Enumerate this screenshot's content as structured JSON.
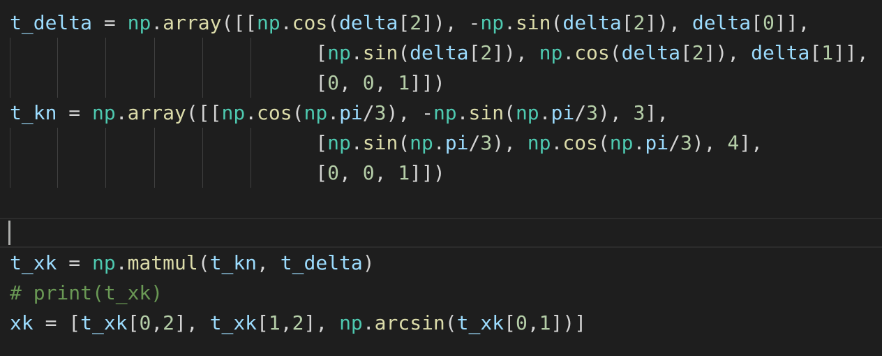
{
  "editor": {
    "theme_colors": {
      "background": "#1e1e1e",
      "variable": "#9cdcfe",
      "module": "#4ec9b0",
      "function": "#dcdcaa",
      "number": "#b5cea8",
      "plain": "#d4d4d4",
      "comment": "#6a9955"
    },
    "lines": [
      {
        "tokens": [
          {
            "t": "t_delta",
            "k": "var"
          },
          {
            "t": " = ",
            "k": "op"
          },
          {
            "t": "np",
            "k": "mod"
          },
          {
            "t": ".",
            "k": "punc"
          },
          {
            "t": "array",
            "k": "fn"
          },
          {
            "t": "([[",
            "k": "brk"
          },
          {
            "t": "np",
            "k": "mod"
          },
          {
            "t": ".",
            "k": "punc"
          },
          {
            "t": "cos",
            "k": "fn"
          },
          {
            "t": "(",
            "k": "brk"
          },
          {
            "t": "delta",
            "k": "var"
          },
          {
            "t": "[",
            "k": "brk"
          },
          {
            "t": "2",
            "k": "num"
          },
          {
            "t": "]), ",
            "k": "brk"
          },
          {
            "t": "-",
            "k": "op"
          },
          {
            "t": "np",
            "k": "mod"
          },
          {
            "t": ".",
            "k": "punc"
          },
          {
            "t": "sin",
            "k": "fn"
          },
          {
            "t": "(",
            "k": "brk"
          },
          {
            "t": "delta",
            "k": "var"
          },
          {
            "t": "[",
            "k": "brk"
          },
          {
            "t": "2",
            "k": "num"
          },
          {
            "t": "]), ",
            "k": "brk"
          },
          {
            "t": "delta",
            "k": "var"
          },
          {
            "t": "[",
            "k": "brk"
          },
          {
            "t": "0",
            "k": "num"
          },
          {
            "t": "]],",
            "k": "brk"
          }
        ]
      },
      {
        "tokens": [
          {
            "t": "                          [",
            "k": "brk"
          },
          {
            "t": "np",
            "k": "mod"
          },
          {
            "t": ".",
            "k": "punc"
          },
          {
            "t": "sin",
            "k": "fn"
          },
          {
            "t": "(",
            "k": "brk"
          },
          {
            "t": "delta",
            "k": "var"
          },
          {
            "t": "[",
            "k": "brk"
          },
          {
            "t": "2",
            "k": "num"
          },
          {
            "t": "]), ",
            "k": "brk"
          },
          {
            "t": "np",
            "k": "mod"
          },
          {
            "t": ".",
            "k": "punc"
          },
          {
            "t": "cos",
            "k": "fn"
          },
          {
            "t": "(",
            "k": "brk"
          },
          {
            "t": "delta",
            "k": "var"
          },
          {
            "t": "[",
            "k": "brk"
          },
          {
            "t": "2",
            "k": "num"
          },
          {
            "t": "]), ",
            "k": "brk"
          },
          {
            "t": "delta",
            "k": "var"
          },
          {
            "t": "[",
            "k": "brk"
          },
          {
            "t": "1",
            "k": "num"
          },
          {
            "t": "]],",
            "k": "brk"
          }
        ]
      },
      {
        "tokens": [
          {
            "t": "                          [",
            "k": "brk"
          },
          {
            "t": "0",
            "k": "num"
          },
          {
            "t": ", ",
            "k": "punc"
          },
          {
            "t": "0",
            "k": "num"
          },
          {
            "t": ", ",
            "k": "punc"
          },
          {
            "t": "1",
            "k": "num"
          },
          {
            "t": "]])",
            "k": "brk"
          }
        ]
      },
      {
        "tokens": [
          {
            "t": "t_kn",
            "k": "var"
          },
          {
            "t": " = ",
            "k": "op"
          },
          {
            "t": "np",
            "k": "mod"
          },
          {
            "t": ".",
            "k": "punc"
          },
          {
            "t": "array",
            "k": "fn"
          },
          {
            "t": "([[",
            "k": "brk"
          },
          {
            "t": "np",
            "k": "mod"
          },
          {
            "t": ".",
            "k": "punc"
          },
          {
            "t": "cos",
            "k": "fn"
          },
          {
            "t": "(",
            "k": "brk"
          },
          {
            "t": "np",
            "k": "mod"
          },
          {
            "t": ".",
            "k": "punc"
          },
          {
            "t": "pi",
            "k": "var"
          },
          {
            "t": "/",
            "k": "op"
          },
          {
            "t": "3",
            "k": "num"
          },
          {
            "t": "), ",
            "k": "brk"
          },
          {
            "t": "-",
            "k": "op"
          },
          {
            "t": "np",
            "k": "mod"
          },
          {
            "t": ".",
            "k": "punc"
          },
          {
            "t": "sin",
            "k": "fn"
          },
          {
            "t": "(",
            "k": "brk"
          },
          {
            "t": "np",
            "k": "mod"
          },
          {
            "t": ".",
            "k": "punc"
          },
          {
            "t": "pi",
            "k": "var"
          },
          {
            "t": "/",
            "k": "op"
          },
          {
            "t": "3",
            "k": "num"
          },
          {
            "t": "), ",
            "k": "brk"
          },
          {
            "t": "3",
            "k": "num"
          },
          {
            "t": "],",
            "k": "brk"
          }
        ]
      },
      {
        "tokens": [
          {
            "t": "                          [",
            "k": "brk"
          },
          {
            "t": "np",
            "k": "mod"
          },
          {
            "t": ".",
            "k": "punc"
          },
          {
            "t": "sin",
            "k": "fn"
          },
          {
            "t": "(",
            "k": "brk"
          },
          {
            "t": "np",
            "k": "mod"
          },
          {
            "t": ".",
            "k": "punc"
          },
          {
            "t": "pi",
            "k": "var"
          },
          {
            "t": "/",
            "k": "op"
          },
          {
            "t": "3",
            "k": "num"
          },
          {
            "t": "), ",
            "k": "brk"
          },
          {
            "t": "np",
            "k": "mod"
          },
          {
            "t": ".",
            "k": "punc"
          },
          {
            "t": "cos",
            "k": "fn"
          },
          {
            "t": "(",
            "k": "brk"
          },
          {
            "t": "np",
            "k": "mod"
          },
          {
            "t": ".",
            "k": "punc"
          },
          {
            "t": "pi",
            "k": "var"
          },
          {
            "t": "/",
            "k": "op"
          },
          {
            "t": "3",
            "k": "num"
          },
          {
            "t": "), ",
            "k": "brk"
          },
          {
            "t": "4",
            "k": "num"
          },
          {
            "t": "],",
            "k": "brk"
          }
        ]
      },
      {
        "tokens": [
          {
            "t": "                          [",
            "k": "brk"
          },
          {
            "t": "0",
            "k": "num"
          },
          {
            "t": ", ",
            "k": "punc"
          },
          {
            "t": "0",
            "k": "num"
          },
          {
            "t": ", ",
            "k": "punc"
          },
          {
            "t": "1",
            "k": "num"
          },
          {
            "t": "]])",
            "k": "brk"
          }
        ]
      },
      {
        "tokens": []
      },
      {
        "tokens": [],
        "current": true
      },
      {
        "tokens": [
          {
            "t": "t_xk",
            "k": "var"
          },
          {
            "t": " = ",
            "k": "op"
          },
          {
            "t": "np",
            "k": "mod"
          },
          {
            "t": ".",
            "k": "punc"
          },
          {
            "t": "matmul",
            "k": "fn"
          },
          {
            "t": "(",
            "k": "brk"
          },
          {
            "t": "t_kn",
            "k": "var"
          },
          {
            "t": ", ",
            "k": "punc"
          },
          {
            "t": "t_delta",
            "k": "var"
          },
          {
            "t": ")",
            "k": "brk"
          }
        ]
      },
      {
        "tokens": [
          {
            "t": "# print(t_xk)",
            "k": "cmt"
          }
        ]
      },
      {
        "tokens": [
          {
            "t": "xk",
            "k": "var"
          },
          {
            "t": " = [",
            "k": "op"
          },
          {
            "t": "t_xk",
            "k": "var"
          },
          {
            "t": "[",
            "k": "brk"
          },
          {
            "t": "0",
            "k": "num"
          },
          {
            "t": ",",
            "k": "punc"
          },
          {
            "t": "2",
            "k": "num"
          },
          {
            "t": "], ",
            "k": "brk"
          },
          {
            "t": "t_xk",
            "k": "var"
          },
          {
            "t": "[",
            "k": "brk"
          },
          {
            "t": "1",
            "k": "num"
          },
          {
            "t": ",",
            "k": "punc"
          },
          {
            "t": "2",
            "k": "num"
          },
          {
            "t": "], ",
            "k": "brk"
          },
          {
            "t": "np",
            "k": "mod"
          },
          {
            "t": ".",
            "k": "punc"
          },
          {
            "t": "arcsin",
            "k": "fn"
          },
          {
            "t": "(",
            "k": "brk"
          },
          {
            "t": "t_xk",
            "k": "var"
          },
          {
            "t": "[",
            "k": "brk"
          },
          {
            "t": "0",
            "k": "num"
          },
          {
            "t": ",",
            "k": "punc"
          },
          {
            "t": "1",
            "k": "num"
          },
          {
            "t": "])]",
            "k": "brk"
          }
        ]
      }
    ]
  }
}
